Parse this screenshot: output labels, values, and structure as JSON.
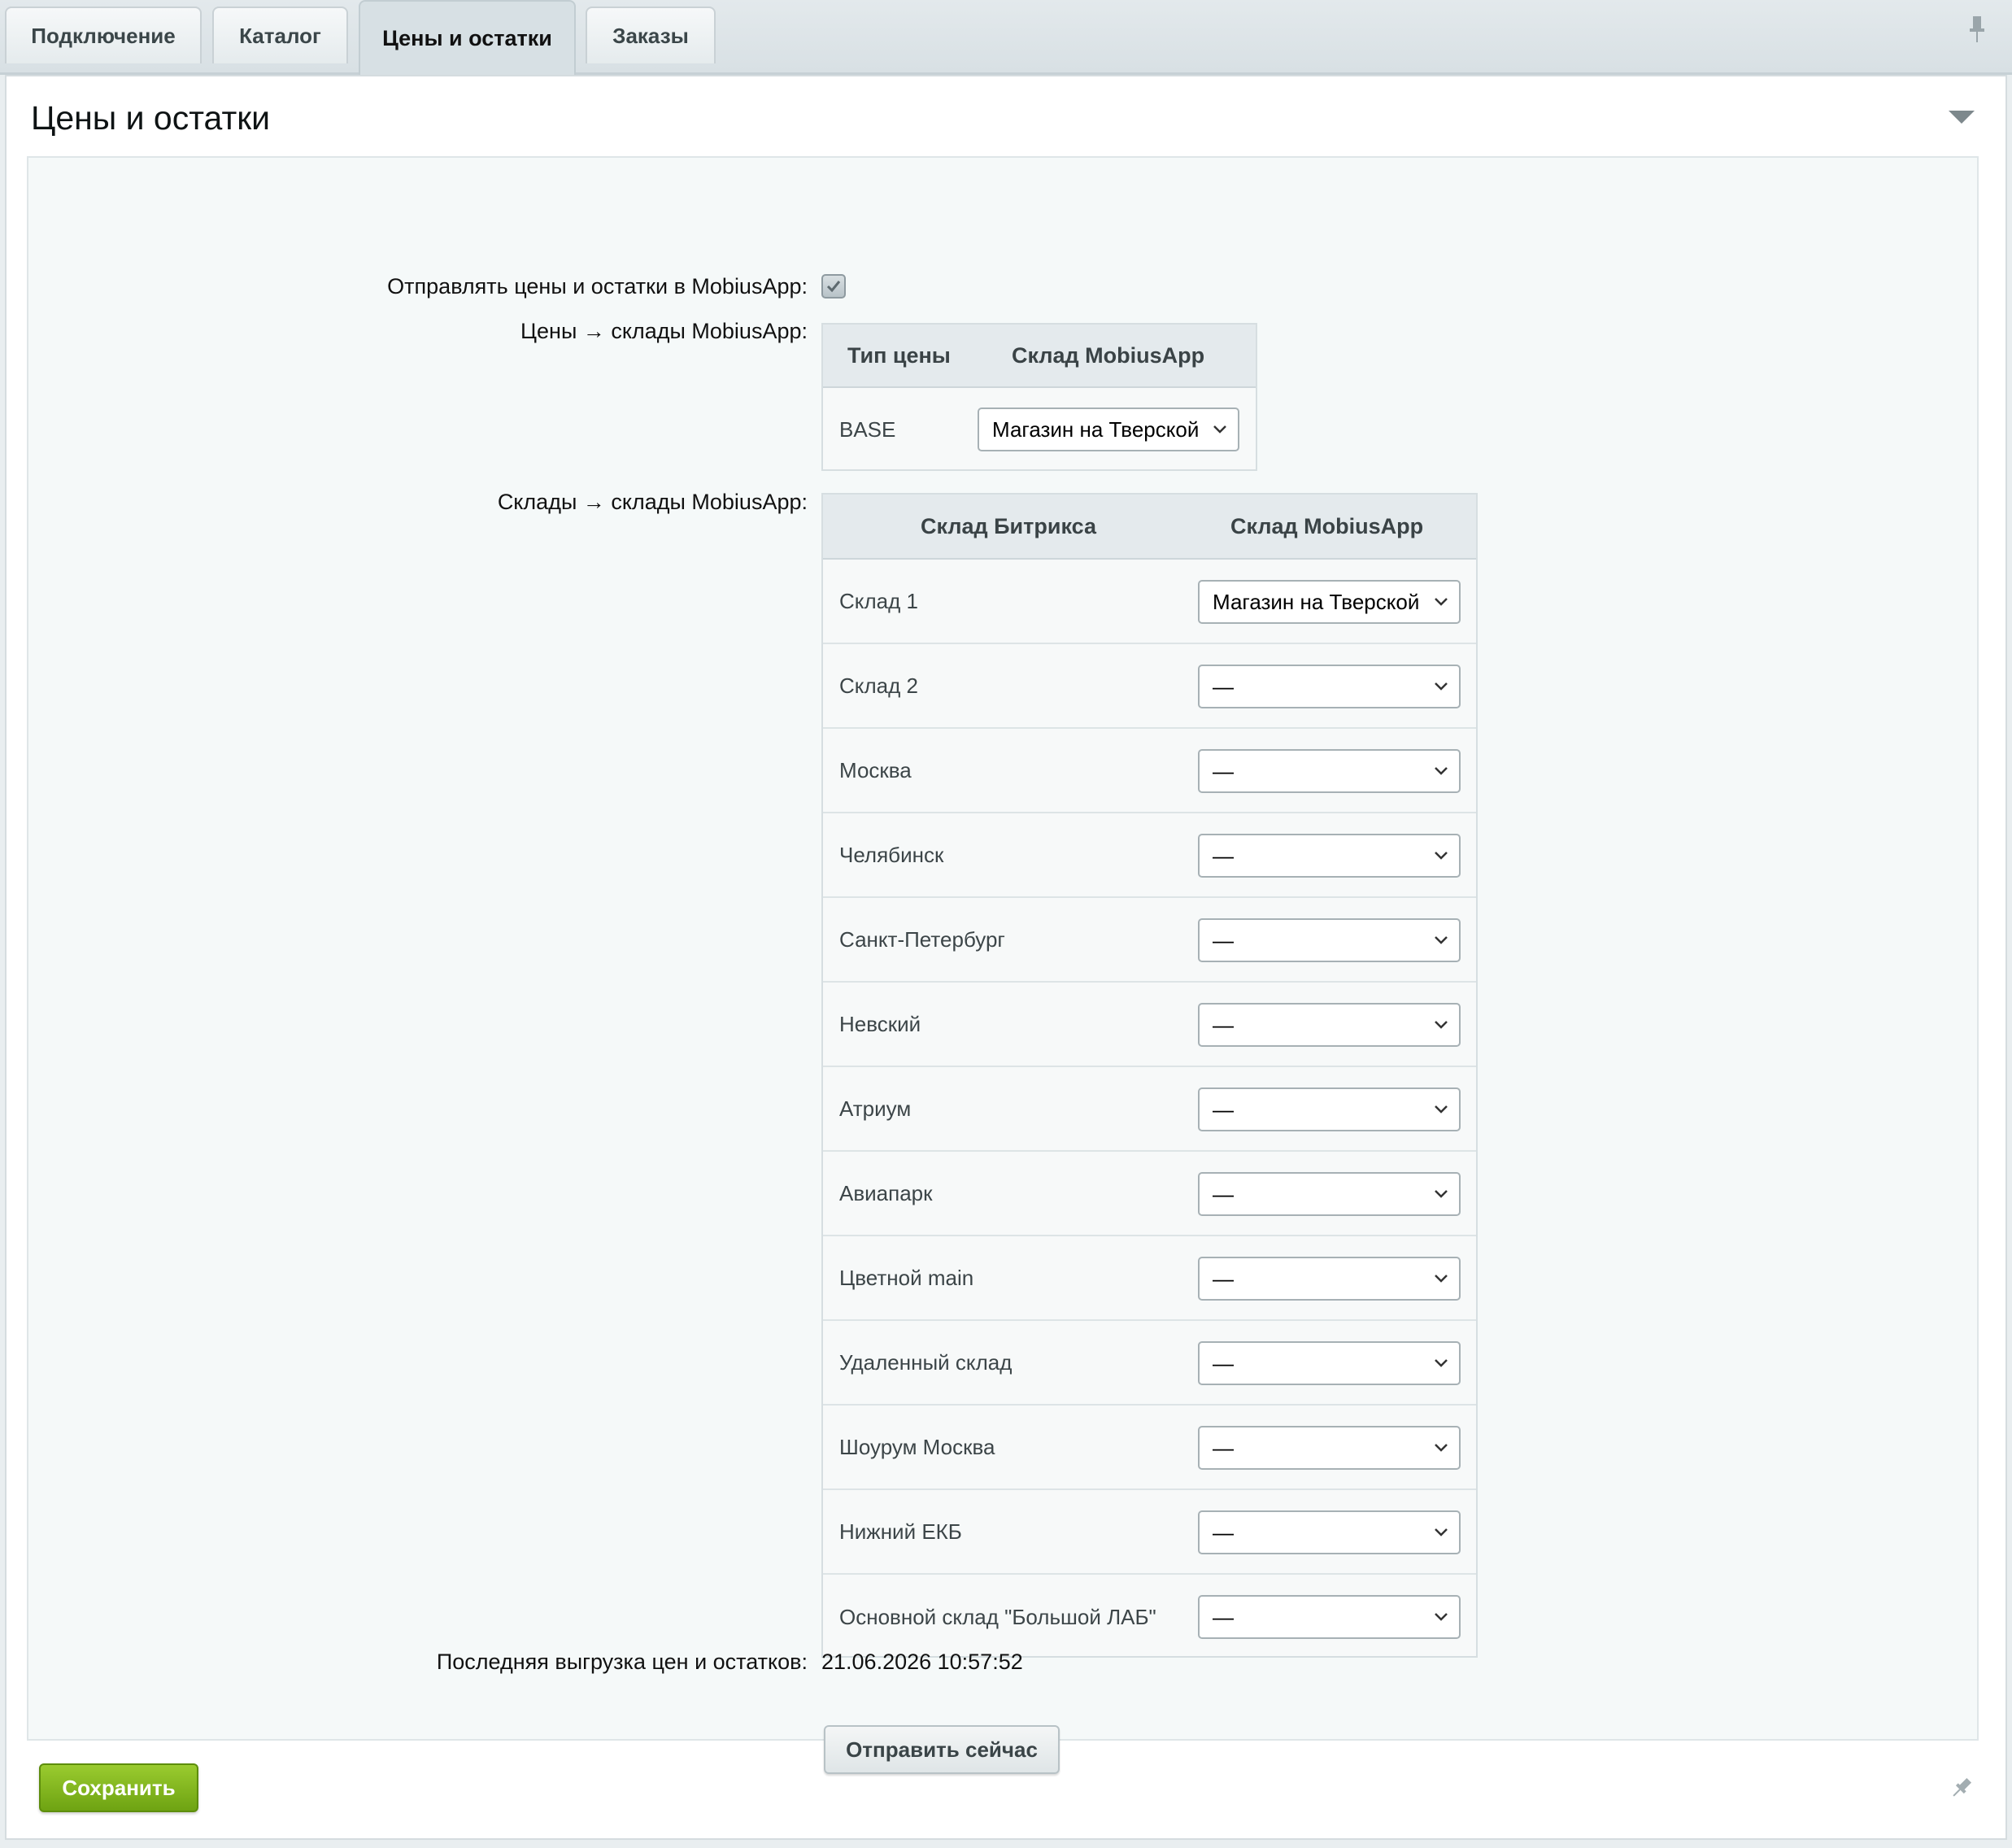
{
  "tabs": [
    {
      "label": "Подключение",
      "active": false
    },
    {
      "label": "Каталог",
      "active": false
    },
    {
      "label": "Цены и остатки",
      "active": true
    },
    {
      "label": "Заказы",
      "active": false
    }
  ],
  "section": {
    "title": "Цены и остатки"
  },
  "form": {
    "send_label": "Отправлять цены и остатки в MobiusApp:",
    "send_checked": true,
    "prices_label": "Цены → склады MobiusApp:",
    "stores_label": "Склады → склады MobiusApp:",
    "last_export_label": "Последняя выгрузка цен и остатков:",
    "last_export_value": "21.06.2026 10:57:52",
    "send_now_button": "Отправить сейчас",
    "save_button": "Сохранить"
  },
  "prices_table": {
    "headers": [
      "Тип цены",
      "Склад MobiusApp"
    ],
    "rows": [
      {
        "price_type": "BASE",
        "store": "Магазин на Тверской"
      }
    ]
  },
  "stores_table": {
    "headers": [
      "Склад Битрикса",
      "Склад MobiusApp"
    ],
    "rows": [
      {
        "name": "Склад 1",
        "value": "Магазин на Тверской"
      },
      {
        "name": "Склад 2",
        "value": "—"
      },
      {
        "name": "Москва",
        "value": "—"
      },
      {
        "name": "Челябинск",
        "value": "—"
      },
      {
        "name": "Санкт-Петербург",
        "value": "—"
      },
      {
        "name": "Невский",
        "value": "—"
      },
      {
        "name": "Атриум",
        "value": "—"
      },
      {
        "name": "Авиапарк",
        "value": "—"
      },
      {
        "name": "Цветной main",
        "value": "—"
      },
      {
        "name": "Удаленный склад",
        "value": "—"
      },
      {
        "name": "Шоурум Москва",
        "value": "—"
      },
      {
        "name": "Нижний ЕКБ",
        "value": "—"
      },
      {
        "name": "Основной склад \"Большой ЛАБ\"",
        "value": "—"
      }
    ]
  },
  "colors": {
    "save_button": "#7cb01b",
    "tab_bar": "#dde4e7",
    "content_bg": "#f5f9f9"
  },
  "icons": [
    "pin-icon",
    "collapse-triangle-icon",
    "checkmark-icon",
    "chevron-down-icon"
  ]
}
